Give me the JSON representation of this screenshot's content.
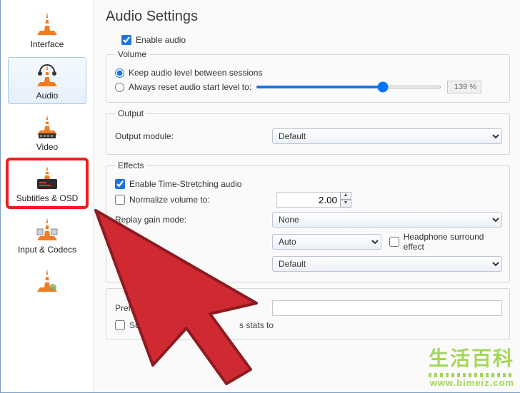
{
  "page_title": "Audio Settings",
  "sidebar": {
    "items": [
      {
        "label": "Interface"
      },
      {
        "label": "Audio"
      },
      {
        "label": "Video"
      },
      {
        "label": "Subtitles & OSD"
      },
      {
        "label": "Input & Codecs"
      }
    ]
  },
  "enable_audio": {
    "label": "Enable audio",
    "checked": true
  },
  "volume": {
    "legend": "Volume",
    "keep_label": "Keep audio level between sessions",
    "reset_label": "Always reset audio start level to:",
    "percent": "139 %"
  },
  "output": {
    "legend": "Output",
    "module_label": "Output module:",
    "module_value": "Default"
  },
  "effects": {
    "legend": "Effects",
    "time_stretch": {
      "label": "Enable Time-Stretching audio",
      "checked": true
    },
    "normalize": {
      "label": "Normalize volume to:",
      "checked": false,
      "value": "2.00"
    },
    "replay_gain": {
      "label": "Replay gain mode:",
      "value": "None"
    },
    "secondary_select": "Auto",
    "headphone_label": "Headphone surround effect",
    "third_select": "Default"
  },
  "bottom": {
    "prefer_label": "Prefer",
    "submit_label": "Submi",
    "stats_label": "s stats to"
  },
  "watermark": {
    "zh": "生活百科",
    "url": "www.bimeiz.com"
  }
}
